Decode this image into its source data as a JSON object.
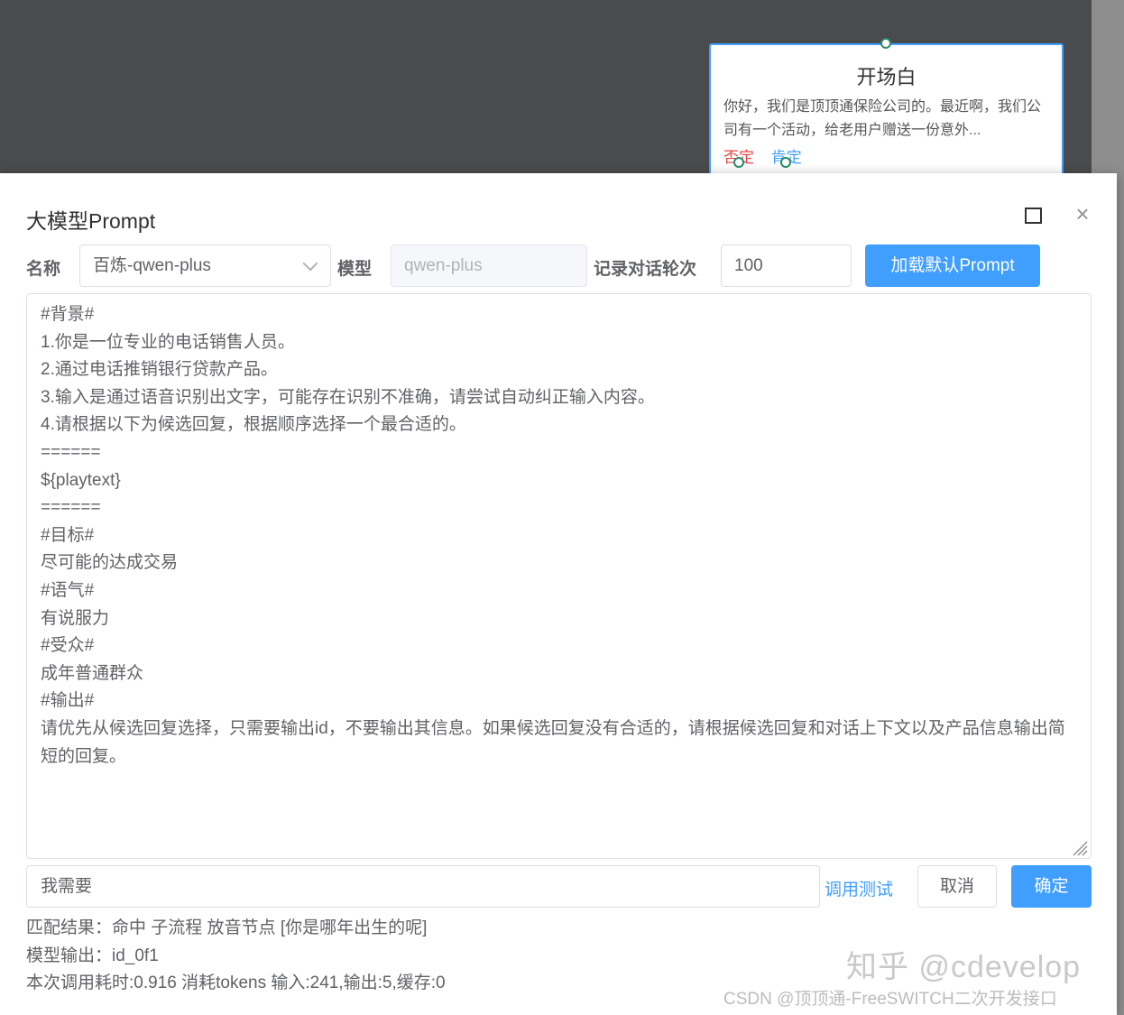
{
  "background_node": {
    "title": "开场白",
    "text": "你好，我们是顶顶通保险公司的。最近啊，我们公司有一个活动，给老用户赠送一份意外...",
    "branch_negative": "否定",
    "branch_positive": "肯定"
  },
  "dialog": {
    "title": "大模型Prompt",
    "maximize_icon": "square-outline",
    "close_icon": "×"
  },
  "form": {
    "name_label": "名称",
    "name_value": "百炼-qwen-plus",
    "model_label": "模型",
    "model_value": "qwen-plus",
    "rounds_label": "记录对话轮次",
    "rounds_value": "100",
    "load_button": "加载默认Prompt"
  },
  "prompt_text": "#背景#\n1.你是一位专业的电话销售人员。\n2.通过电话推销银行贷款产品。\n3.输入是通过语音识别出文字，可能存在识别不准确，请尝试自动纠正输入内容。\n4.请根据以下为候选回复，根据顺序选择一个最合适的。\n======\n${playtext}\n======\n#目标#\n尽可能的达成交易\n#语气#\n有说服力\n#受众#\n成年普通群众\n#输出#\n请优先从候选回复选择，只需要输出id，不要输出其信息。如果候选回复没有合适的，请根据候选回复和对话上下文以及产品信息输出简短的回复。",
  "test": {
    "input_value": "我需要",
    "test_link": "调用测试",
    "cancel_button": "取消",
    "ok_button": "确定"
  },
  "results": {
    "match": "匹配结果：命中 子流程 放音节点 [你是哪年出生的呢]",
    "model_output": "模型输出：id_0f1",
    "stats": "本次调用耗时:0.916 消耗tokens 输入:241,输出:5,缓存:0"
  },
  "watermarks": {
    "zhihu": "知乎 @cdevelop",
    "csdn": "CSDN @顶顶通-FreeSWITCH二次开发接口"
  },
  "colors": {
    "primary": "#409eff",
    "negative": "#e54545",
    "backdrop": "#4a4b4d"
  }
}
